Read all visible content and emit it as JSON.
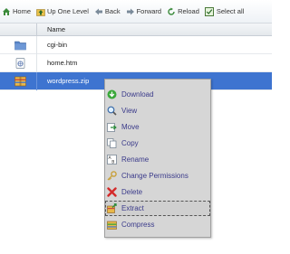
{
  "toolbar": {
    "home": "Home",
    "up": "Up One Level",
    "back": "Back",
    "forward": "Forward",
    "reload": "Reload",
    "select_all": "Select all"
  },
  "table": {
    "column_name": "Name",
    "rows": [
      {
        "name": "cgi-bin",
        "icon": "folder-icon",
        "selected": false
      },
      {
        "name": "home.htm",
        "icon": "html-file-icon",
        "selected": false
      },
      {
        "name": "wordpress.zip",
        "icon": "archive-icon",
        "selected": true
      }
    ]
  },
  "context_menu": {
    "items": [
      {
        "label": "Download",
        "icon": "download-icon"
      },
      {
        "label": "View",
        "icon": "magnifier-icon"
      },
      {
        "label": "Move",
        "icon": "move-icon"
      },
      {
        "label": "Copy",
        "icon": "copy-icon"
      },
      {
        "label": "Rename",
        "icon": "rename-icon"
      },
      {
        "label": "Change Permissions",
        "icon": "key-icon"
      },
      {
        "label": "Delete",
        "icon": "delete-icon"
      },
      {
        "label": "Extract",
        "icon": "extract-icon",
        "hovered": true
      },
      {
        "label": "Compress",
        "icon": "compress-icon"
      }
    ]
  },
  "colors": {
    "selection": "#3e74d0",
    "menu_background": "#d6d6d6",
    "menu_text": "#3a3a8a"
  }
}
